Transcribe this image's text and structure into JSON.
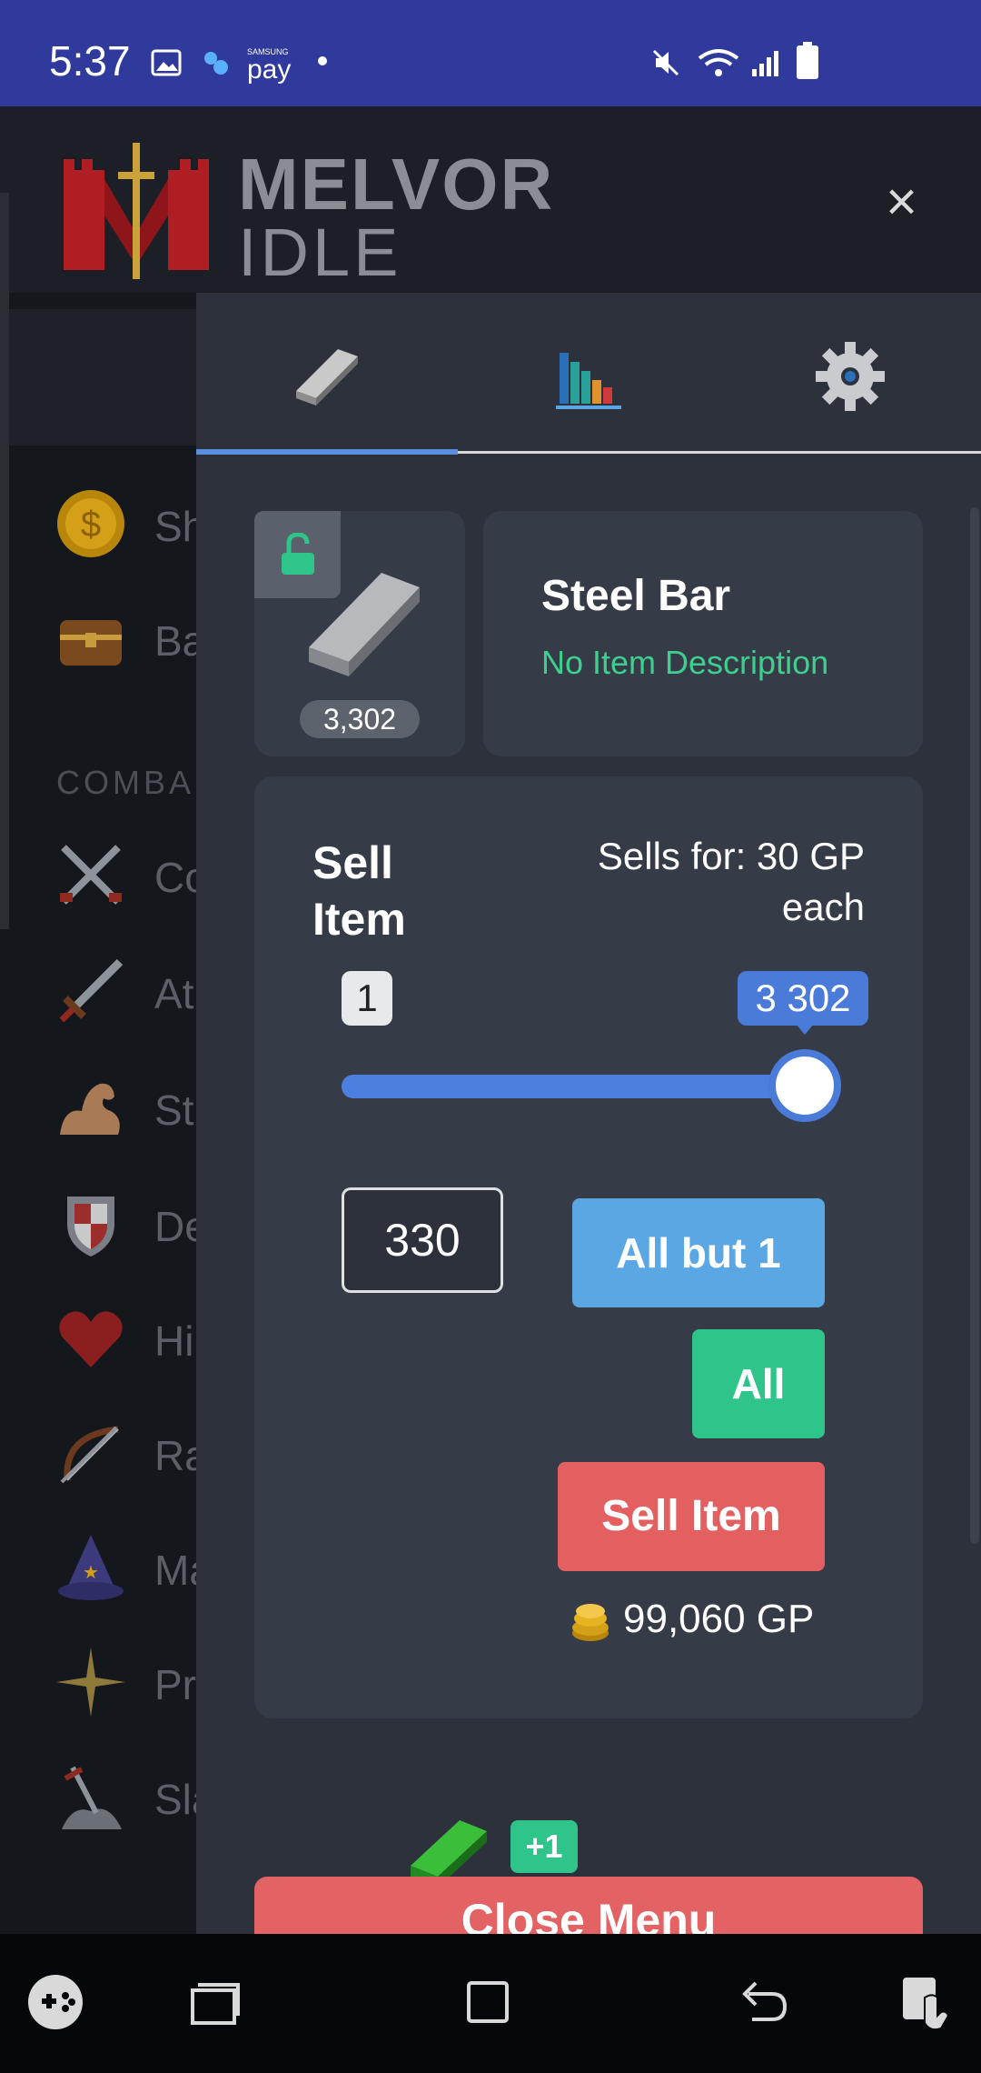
{
  "status_bar": {
    "time": "5:37",
    "pay_label": "pay",
    "pay_brand": "SAMSUNG"
  },
  "header": {
    "logo_line1": "MELVOR",
    "logo_line2": "IDLE",
    "close_symbol": "×"
  },
  "sidebar": {
    "section_label": "COMBA",
    "items": [
      {
        "label": "Sh",
        "icon": "coin-icon"
      },
      {
        "label": "Ba",
        "icon": "chest-icon"
      },
      {
        "label": "Co",
        "icon": "crossed-swords-icon"
      },
      {
        "label": "At",
        "icon": "sword-icon"
      },
      {
        "label": "St",
        "icon": "muscle-icon"
      },
      {
        "label": "De",
        "icon": "shield-icon"
      },
      {
        "label": "Hi",
        "icon": "heart-icon"
      },
      {
        "label": "Ra",
        "icon": "bow-icon"
      },
      {
        "label": "Ma",
        "icon": "wizard-hat-icon"
      },
      {
        "label": "Pr",
        "icon": "sparkle-icon"
      },
      {
        "label": "Sla",
        "icon": "sword-in-stone-icon"
      }
    ]
  },
  "tabs": [
    {
      "name": "item",
      "icon": "bar-icon",
      "active": true
    },
    {
      "name": "stats",
      "icon": "bar-chart-icon",
      "active": false
    },
    {
      "name": "settings",
      "icon": "gear-icon",
      "active": false
    }
  ],
  "item": {
    "quantity": "3,302",
    "name": "Steel Bar",
    "description": "No Item Description",
    "lock_state": "unlocked"
  },
  "sell": {
    "title": "Sell Item",
    "sells_for": "Sells for: 30 GP each",
    "slider_min": "1",
    "slider_max": "3 302",
    "slider_fraction": 1.0,
    "quantity_input": "330",
    "all_but_one_label": "All but 1",
    "all_label": "All",
    "sell_label": "Sell Item",
    "total": "99,060 GP"
  },
  "notification": {
    "badge": "+1"
  },
  "footer": {
    "close_label": "Close Menu"
  },
  "colors": {
    "status_bar": "#2f3a9c",
    "accent_blue": "#4a7bd8",
    "success_green": "#2fc48a",
    "danger_red": "#e35f60",
    "info_blue": "#5aa7e3"
  }
}
